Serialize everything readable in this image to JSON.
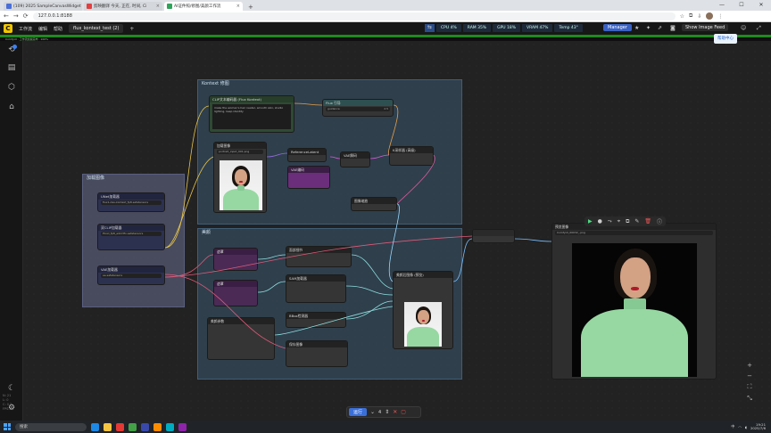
{
  "browser": {
    "tabs": [
      {
        "label": "(109) 2025 SampleCanvasWidget",
        "color": "#4a6fd8",
        "active": false
      },
      {
        "label": "剪映翻译 今天, 正在, 时间, Ci",
        "color": "#e04040",
        "active": false
      },
      {
        "label": "AI证件照/修图/美颜工作流",
        "color": "#2fa35a",
        "active": true
      }
    ],
    "new_tab": "+",
    "url": "127.0.0.1:8188",
    "win_controls": [
      "—",
      "☐",
      "✕"
    ]
  },
  "menubar": {
    "items": [
      "工作流",
      "编辑",
      "帮助"
    ],
    "workflow_tab": "flux_kontext_test (2)",
    "monitors": [
      "CPU 4%",
      "RAM 35%",
      "GPU 18%",
      "VRAM 47%",
      "Temp 43°"
    ],
    "manager_label": "Manager",
    "image_feed_label": "Show Image Feed"
  },
  "subbar_text": "ComfyUI · 工作流加载完毕 · 100%",
  "sidebar": {
    "badge_color": "#3b82f6",
    "icons": [
      "queue-icon",
      "node-library-icon",
      "model-library-icon",
      "workflows-icon",
      "theme-icon",
      "settings-icon"
    ],
    "info_lines": [
      "N: 21",
      "L: 0",
      "C: 0.2",
      "FPS: 0"
    ]
  },
  "help_button": "帮助中心",
  "groups": [
    {
      "title": "Kontext 修图"
    },
    {
      "title": "加载图像"
    },
    {
      "title": "美颜"
    }
  ],
  "nodes": {
    "prompt": {
      "title": "CLIP文本编码器 (Flux Kontext)",
      "text": "make the woman's hair neater, smooth skin, studio lighting, keep identity"
    },
    "guidance": {
      "title": "Flux 引导",
      "value": "2.5"
    },
    "load_image": {
      "title": "加载图像",
      "filename": "portrait_input_001.png"
    },
    "reference": {
      "title": "ReferenceLatent"
    },
    "vae_encode": {
      "title": "VAE编码"
    },
    "ksampler": {
      "title": "K采样器 (高级)"
    },
    "vae_decode": {
      "title": "VAE解码"
    },
    "unet_loader": {
      "title": "UNet加载器",
      "value": "flux1-dev-kontext_fp8.safetensors"
    },
    "dual_clip": {
      "title": "双CLIP加载器",
      "value": "t5xxl_fp8_e4m3fn.safetensors"
    },
    "vae_loader": {
      "title": "VAE加载器",
      "value": "ae.safetensors"
    },
    "mask1": {
      "title": "遮罩"
    },
    "mask2": {
      "title": "遮罩"
    },
    "face_detail": {
      "title": "面部细节"
    },
    "sam": {
      "title": "SAM加载器"
    },
    "bbox": {
      "title": "BBox检测器"
    },
    "upscale": {
      "title": "图像缩放"
    },
    "settings": {
      "title": "美颜参数"
    },
    "beauty_out": {
      "title": "美颜后图像 (预览)"
    },
    "save": {
      "title": "保存图像"
    },
    "preview": {
      "title": "预览图像",
      "filename": "ComfyUI_00032_.png"
    }
  },
  "queue": {
    "run_label": "运行",
    "count": "4"
  },
  "taskbar": {
    "search_placeholder": "搜索",
    "time": "19:21",
    "date": "2025/7/6",
    "lang": "中"
  }
}
